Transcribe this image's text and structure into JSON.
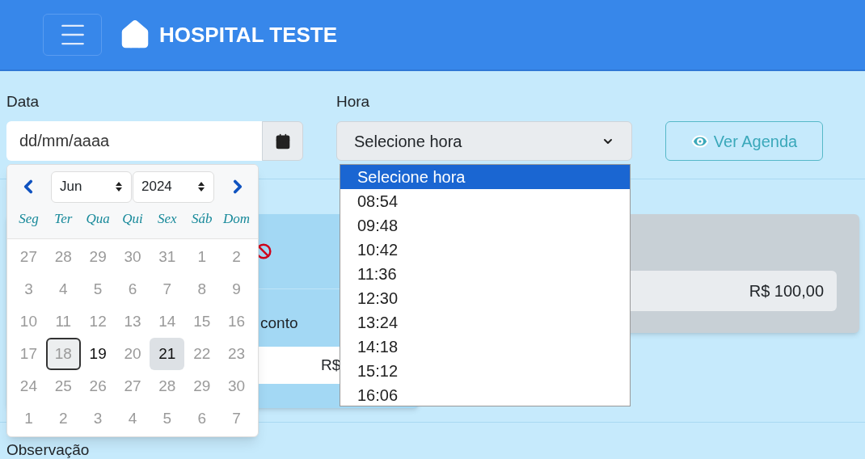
{
  "header": {
    "title": "HOSPITAL TESTE"
  },
  "form": {
    "date": {
      "label": "Data",
      "placeholder": "dd/mm/aaaa"
    },
    "time": {
      "label": "Hora",
      "value": "Selecione hora"
    },
    "view_button": "Ver Agenda"
  },
  "date_picker": {
    "month": "Jun",
    "year": "2024",
    "weekdays": [
      "Seg",
      "Ter",
      "Qua",
      "Qui",
      "Sex",
      "Sáb",
      "Dom"
    ],
    "days": [
      {
        "label": "27",
        "disabled": true,
        "today": false,
        "selected": false
      },
      {
        "label": "28",
        "disabled": true,
        "today": false,
        "selected": false
      },
      {
        "label": "29",
        "disabled": true,
        "today": false,
        "selected": false
      },
      {
        "label": "30",
        "disabled": true,
        "today": false,
        "selected": false
      },
      {
        "label": "31",
        "disabled": true,
        "today": false,
        "selected": false
      },
      {
        "label": "1",
        "disabled": true,
        "today": false,
        "selected": false
      },
      {
        "label": "2",
        "disabled": true,
        "today": false,
        "selected": false
      },
      {
        "label": "3",
        "disabled": true,
        "today": false,
        "selected": false
      },
      {
        "label": "4",
        "disabled": true,
        "today": false,
        "selected": false
      },
      {
        "label": "5",
        "disabled": true,
        "today": false,
        "selected": false
      },
      {
        "label": "6",
        "disabled": true,
        "today": false,
        "selected": false
      },
      {
        "label": "7",
        "disabled": true,
        "today": false,
        "selected": false
      },
      {
        "label": "8",
        "disabled": true,
        "today": false,
        "selected": false
      },
      {
        "label": "9",
        "disabled": true,
        "today": false,
        "selected": false
      },
      {
        "label": "10",
        "disabled": true,
        "today": false,
        "selected": false
      },
      {
        "label": "11",
        "disabled": true,
        "today": false,
        "selected": false
      },
      {
        "label": "12",
        "disabled": true,
        "today": false,
        "selected": false
      },
      {
        "label": "13",
        "disabled": true,
        "today": false,
        "selected": false
      },
      {
        "label": "14",
        "disabled": true,
        "today": false,
        "selected": false
      },
      {
        "label": "15",
        "disabled": true,
        "today": false,
        "selected": false
      },
      {
        "label": "16",
        "disabled": true,
        "today": false,
        "selected": false
      },
      {
        "label": "17",
        "disabled": true,
        "today": false,
        "selected": false
      },
      {
        "label": "18",
        "disabled": true,
        "today": true,
        "selected": false
      },
      {
        "label": "19",
        "disabled": false,
        "today": false,
        "selected": false
      },
      {
        "label": "20",
        "disabled": true,
        "today": false,
        "selected": false
      },
      {
        "label": "21",
        "disabled": false,
        "today": false,
        "selected": true
      },
      {
        "label": "22",
        "disabled": true,
        "today": false,
        "selected": false
      },
      {
        "label": "23",
        "disabled": true,
        "today": false,
        "selected": false
      },
      {
        "label": "24",
        "disabled": true,
        "today": false,
        "selected": false
      },
      {
        "label": "25",
        "disabled": true,
        "today": false,
        "selected": false
      },
      {
        "label": "26",
        "disabled": true,
        "today": false,
        "selected": false
      },
      {
        "label": "27",
        "disabled": true,
        "today": false,
        "selected": false
      },
      {
        "label": "28",
        "disabled": true,
        "today": false,
        "selected": false
      },
      {
        "label": "29",
        "disabled": true,
        "today": false,
        "selected": false
      },
      {
        "label": "30",
        "disabled": true,
        "today": false,
        "selected": false
      },
      {
        "label": "1",
        "disabled": true,
        "today": false,
        "selected": false
      },
      {
        "label": "2",
        "disabled": true,
        "today": false,
        "selected": false
      },
      {
        "label": "3",
        "disabled": true,
        "today": false,
        "selected": false
      },
      {
        "label": "4",
        "disabled": true,
        "today": false,
        "selected": false
      },
      {
        "label": "5",
        "disabled": true,
        "today": false,
        "selected": false
      },
      {
        "label": "6",
        "disabled": true,
        "today": false,
        "selected": false
      },
      {
        "label": "7",
        "disabled": true,
        "today": false,
        "selected": false
      }
    ]
  },
  "time_options": [
    {
      "label": "Selecione hora",
      "selected": true
    },
    {
      "label": "08:54",
      "selected": false
    },
    {
      "label": "09:48",
      "selected": false
    },
    {
      "label": "10:42",
      "selected": false
    },
    {
      "label": "11:36",
      "selected": false
    },
    {
      "label": "12:30",
      "selected": false
    },
    {
      "label": "13:24",
      "selected": false
    },
    {
      "label": "14:18",
      "selected": false
    },
    {
      "label": "15:12",
      "selected": false
    },
    {
      "label": "16:06",
      "selected": false
    }
  ],
  "discount_card": {
    "label": "conto",
    "field_value": "R$"
  },
  "total_card": {
    "field_value": "R$ 100,00"
  },
  "notes": {
    "label": "Observação"
  }
}
